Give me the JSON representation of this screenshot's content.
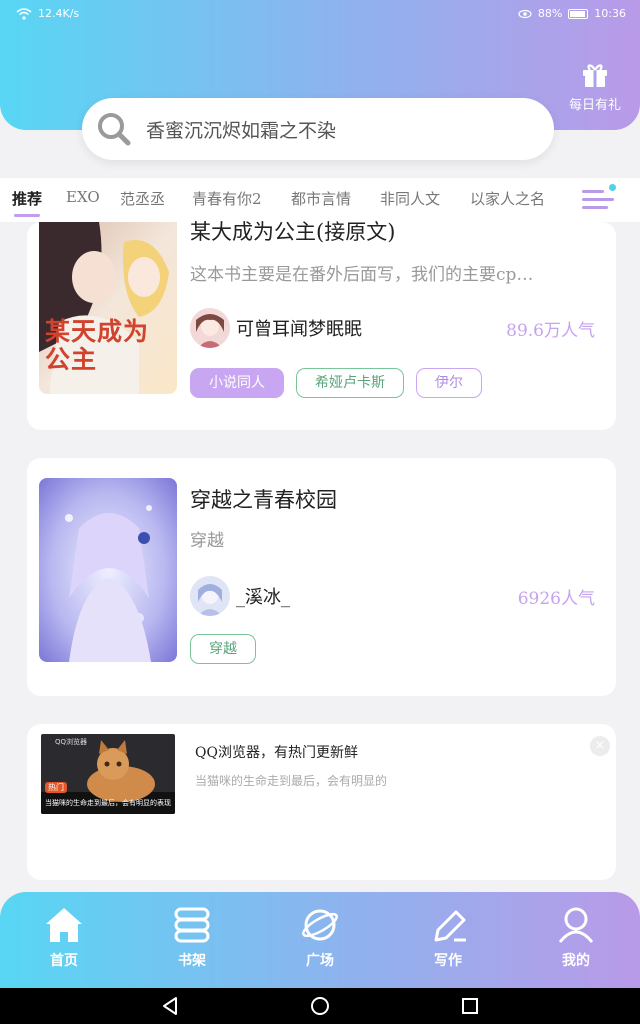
{
  "status_bar": {
    "network_speed": "12.4K/s",
    "battery": "88%",
    "time": "10:36"
  },
  "header": {
    "gift_label": "每日有礼"
  },
  "search": {
    "query": "香蜜沉沉烬如霜之不染"
  },
  "tabs": [
    "推荐",
    "EXO",
    "范丞丞",
    "青春有你2",
    "都市言情",
    "非同人文",
    "以家人之名"
  ],
  "books": [
    {
      "title": "某大成为公主(接原文)",
      "description": "这本书主要是在番外后面写，我们的主要cp…",
      "author": "可曾耳闻梦眠眠",
      "popularity": "89.6万人气",
      "tags": [
        "小说同人",
        "希娅卢卡斯",
        "伊尔"
      ],
      "cover_text": "某天成为公主"
    },
    {
      "title": "穿越之青春校园",
      "description": "穿越",
      "author": "_溪冰_",
      "popularity": "6926人气",
      "tags": [
        "穿越"
      ]
    }
  ],
  "ad": {
    "title": "QQ浏览器，有热门更新鲜",
    "subtitle": "当猫咪的生命走到最后，会有明显的",
    "brand": "QQ浏览器",
    "badge": "热门",
    "caption": "当猫咪的生命走到最后，会有明显的表现"
  },
  "bottom_nav": [
    "首页",
    "书架",
    "广场",
    "写作",
    "我的"
  ]
}
